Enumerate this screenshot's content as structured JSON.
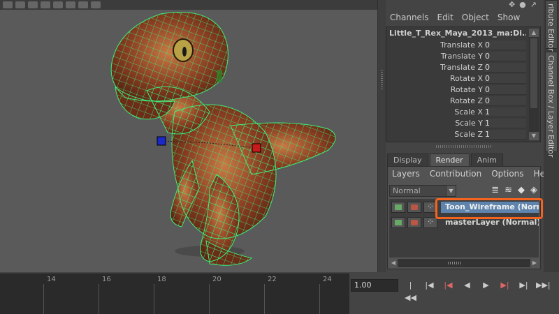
{
  "viewport": {
    "toolbar_icons": [
      "select-icon",
      "mesh-icon",
      "sphere-icon",
      "light-icon",
      "camera-icon",
      "cube-icon",
      "grid-icon",
      "graph-icon"
    ]
  },
  "channel_box": {
    "top_icons": [
      "✥",
      "●",
      "↗"
    ],
    "menus": [
      "Channels",
      "Edit",
      "Object",
      "Show"
    ],
    "node_name": "Little_T_Rex_Maya_2013_ma:Di...",
    "attributes": [
      {
        "label": "Translate X",
        "value": "0"
      },
      {
        "label": "Translate Y",
        "value": "0"
      },
      {
        "label": "Translate Z",
        "value": "0"
      },
      {
        "label": "Rotate X",
        "value": "0"
      },
      {
        "label": "Rotate Y",
        "value": "0"
      },
      {
        "label": "Rotate Z",
        "value": "0"
      },
      {
        "label": "Scale X",
        "value": "1"
      },
      {
        "label": "Scale Y",
        "value": "1"
      },
      {
        "label": "Scale Z",
        "value": "1"
      }
    ]
  },
  "layer_editor": {
    "tabs": [
      "Display",
      "Render",
      "Anim"
    ],
    "active_tab": "Render",
    "menus": [
      "Layers",
      "Contribution",
      "Options",
      "Help"
    ],
    "blend_mode": "Normal",
    "layers": [
      {
        "name": "Toon_Wireframe (Normal)",
        "selected": true
      },
      {
        "name": "masterLayer (Normal)",
        "selected": false
      }
    ]
  },
  "side_tabs": {
    "attribute_editor": "ribute Editor",
    "channel_layer": "Channel Box / Layer Editor"
  },
  "timeline": {
    "ticks": [
      "14",
      "16",
      "18",
      "20",
      "22",
      "24"
    ],
    "current_time": "1.00"
  },
  "playback": {
    "buttons": [
      "go-to-start",
      "step-back-key",
      "step-back-frame",
      "play-backwards",
      "play-forwards",
      "step-forward-frame",
      "step-forward-key",
      "go-to-end"
    ]
  },
  "colors": {
    "highlight": "#f4641e",
    "selection": "#5e84ad",
    "wireframe": "#3cf07a"
  }
}
